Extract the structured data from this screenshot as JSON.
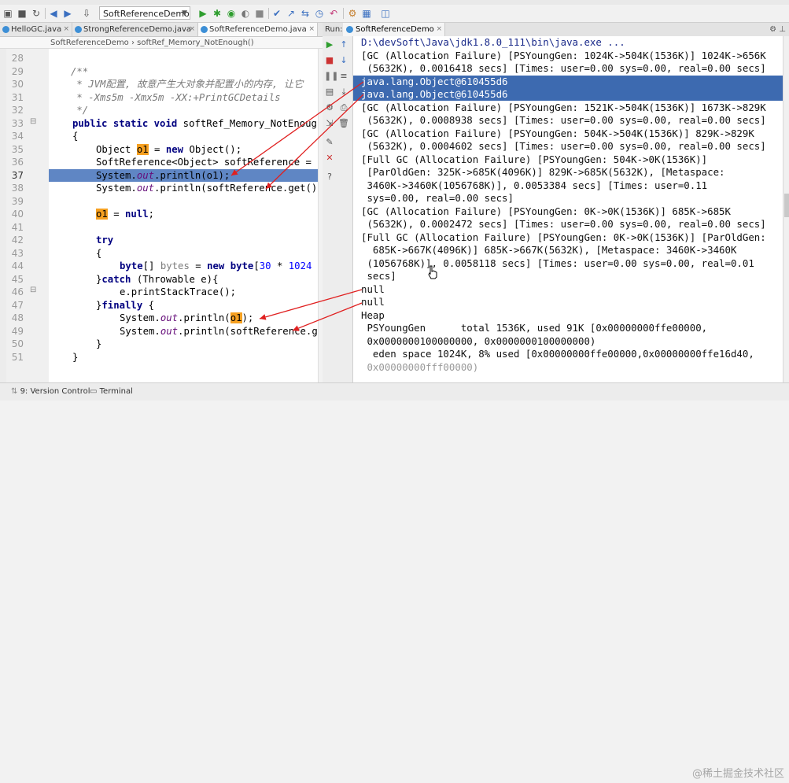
{
  "toolbar": {
    "run_config": "SoftReferenceDemo"
  },
  "editor": {
    "tabs": [
      {
        "label": "HelloGC.java",
        "active": false
      },
      {
        "label": "StrongReferenceDemo.java",
        "active": false
      },
      {
        "label": "SoftReferenceDemo.java",
        "active": true
      }
    ],
    "breadcrumb": "SoftReferenceDemo  ›  softRef_Memory_NotEnough()",
    "line_numbers": [
      "28",
      "29",
      "30",
      "31",
      "32",
      "33",
      "34",
      "35",
      "36",
      "37",
      "38",
      "39",
      "40",
      "41",
      "42",
      "43",
      "44",
      "45",
      "46",
      "47",
      "48",
      "49",
      "50",
      "51"
    ],
    "code": {
      "l29": "/**",
      "l30": " * JVM配置, 故意产生大对象并配置小的内存, 让它",
      "l31": " * -Xms5m -Xmx5m -XX:+PrintGCDetails",
      "l32": " */",
      "l33_kw": "public static void ",
      "l33_rest": "softRef_Memory_NotEnough",
      "l34": "{",
      "l35_a": "Object ",
      "l35_var": "o1",
      "l35_b": " = ",
      "l35_kw": "new ",
      "l35_c": "Object();",
      "l36": "SoftReference<Object> softReference = ",
      "l37_a": "System.",
      "l37_fld": "out",
      "l37_b": ".println(o1);",
      "l38_a": "System.",
      "l38_fld": "out",
      "l38_b": ".println(softReference.get()",
      "l40_var": "o1",
      "l40_b": " = ",
      "l40_kw": "null",
      "l40_c": ";",
      "l42_kw": "try",
      "l43": "{",
      "l44_kw": "byte",
      "l44_a": "[] ",
      "l44_gray": "bytes",
      "l44_b": " = ",
      "l44_kw2": "new byte",
      "l44_c": "[",
      "l44_num": "30",
      "l44_d": " * ",
      "l44_num2": "1024",
      "l45_a": "}",
      "l45_kw": "catch",
      "l45_b": " (Throwable e){",
      "l46": "e.printStackTrace();",
      "l47_a": "}",
      "l47_kw": "finally",
      "l47_b": " {",
      "l48_a": "System.",
      "l48_fld": "out",
      "l48_b": ".println(",
      "l48_var": "o1",
      "l48_c": ");",
      "l49_a": "System.",
      "l49_fld": "out",
      "l49_b": ".println(softReference.g",
      "l50": "}",
      "l51": "}"
    }
  },
  "run_panel": {
    "label": "Run:",
    "tab": "SoftReferenceDemo",
    "console_lines": [
      "D:\\devSoft\\Java\\jdk1.8.0_111\\bin\\java.exe ...",
      "[GC (Allocation Failure) [PSYoungGen: 1024K->504K(1536K)] 1024K->656K",
      " (5632K), 0.0016418 secs] [Times: user=0.00 sys=0.00, real=0.00 secs]",
      "java.lang.Object@610455d6",
      "java.lang.Object@610455d6",
      "[GC (Allocation Failure) [PSYoungGen: 1521K->504K(1536K)] 1673K->829K",
      " (5632K), 0.0008938 secs] [Times: user=0.00 sys=0.00, real=0.00 secs]",
      "[GC (Allocation Failure) [PSYoungGen: 504K->504K(1536K)] 829K->829K",
      " (5632K), 0.0004602 secs] [Times: user=0.00 sys=0.00, real=0.00 secs]",
      "[Full GC (Allocation Failure) [PSYoungGen: 504K->0K(1536K)]",
      " [ParOldGen: 325K->685K(4096K)] 829K->685K(5632K), [Metaspace:",
      " 3460K->3460K(1056768K)], 0.0053384 secs] [Times: user=0.11",
      " sys=0.00, real=0.00 secs]",
      "[GC (Allocation Failure) [PSYoungGen: 0K->0K(1536K)] 685K->685K",
      " (5632K), 0.0002472 secs] [Times: user=0.00 sys=0.00, real=0.00 secs]",
      "[Full GC (Allocation Failure) [PSYoungGen: 0K->0K(1536K)] [ParOldGen:",
      "  685K->667K(4096K)] 685K->667K(5632K), [Metaspace: 3460K->3460K",
      " (1056768K)], 0.0058118 secs] [Times: user=0.00 sys=0.00, real=0.01",
      " secs]",
      "null",
      "null",
      "Heap",
      " PSYoungGen      total 1536K, used 91K [0x00000000ffe00000,",
      " 0x0000000100000000, 0x0000000100000000)",
      "  eden space 1024K, 8% used [0x00000000ffe00000,0x00000000ffe16d40,",
      " 0x00000000fff00000)"
    ]
  },
  "bottom": {
    "version_control": "9: Version Control",
    "terminal": "Terminal",
    "watermark": "@稀土掘金技术社区"
  }
}
